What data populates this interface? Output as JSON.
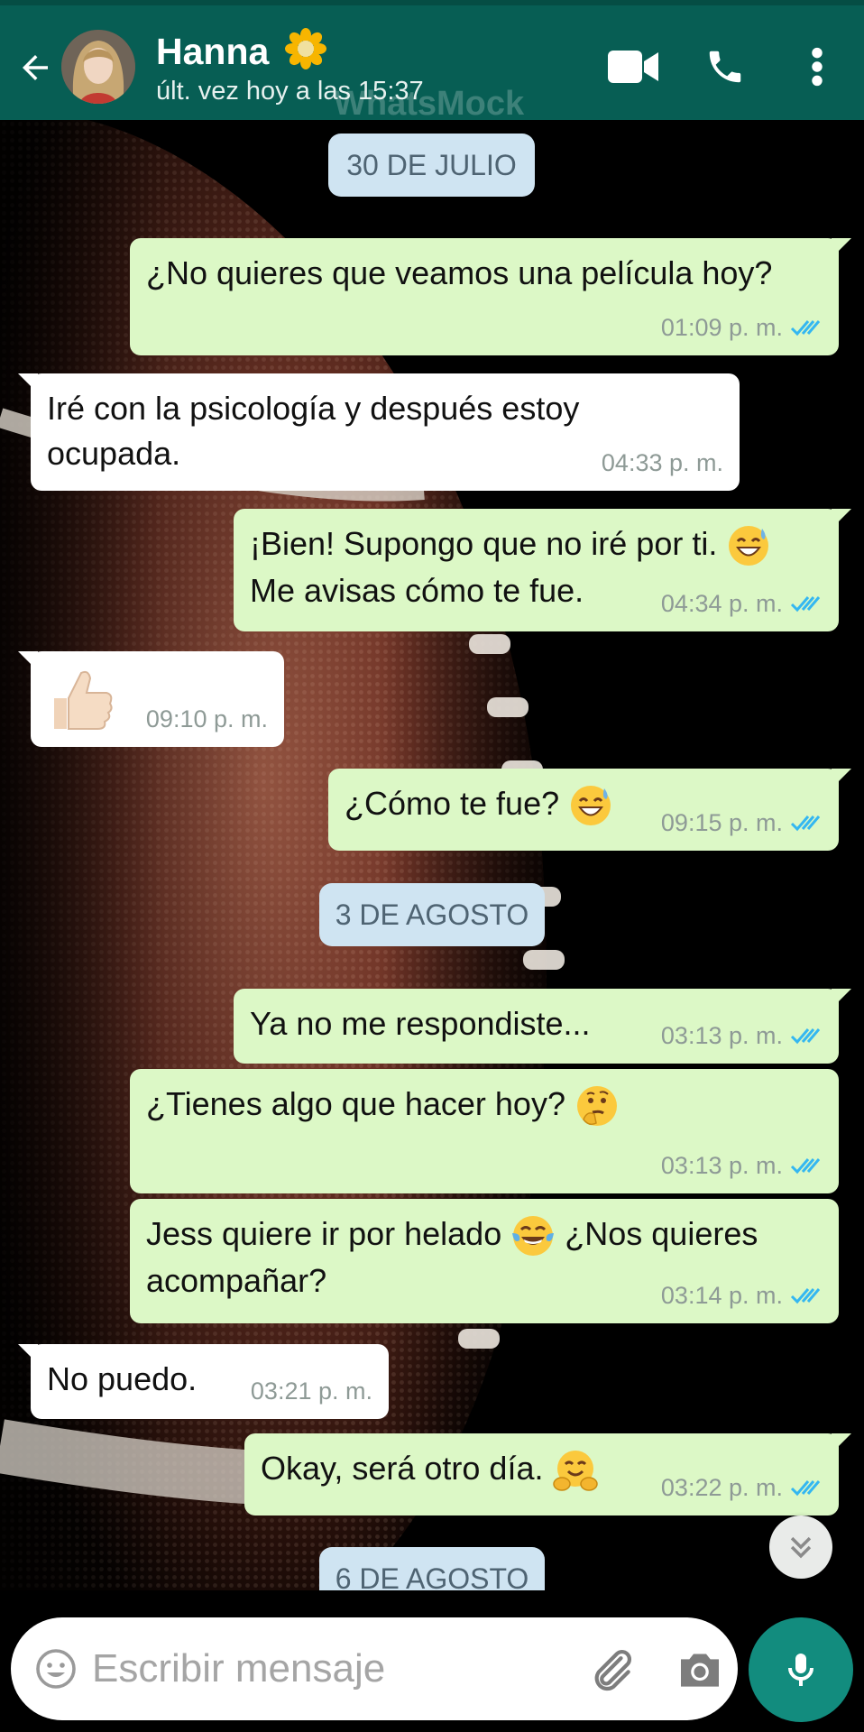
{
  "header": {
    "contact_name": "Hanna",
    "status": "últ. vez hoy a las 15:37",
    "watermark": "WhatsMock",
    "colors": {
      "bar": "#075e54"
    },
    "icons": [
      "back-arrow-icon",
      "video-call-icon",
      "phone-icon",
      "more-options-icon"
    ]
  },
  "dates": [
    "30 DE JULIO",
    "3 DE AGOSTO",
    "6 DE AGOSTO"
  ],
  "messages": [
    {
      "dir": "out",
      "text": "¿No quieres que veamos una película hoy?",
      "time": "01:09 p. m.",
      "read": true
    },
    {
      "dir": "in",
      "text": "Iré con la psicología y después estoy ocupada.",
      "time": "04:33 p. m."
    },
    {
      "dir": "out",
      "text": "¡Bien! Supongo que no iré por ti.",
      "text2": "Me avisas cómo te fue.",
      "emoji": "grinning-sweat",
      "time": "04:34 p. m.",
      "read": true
    },
    {
      "dir": "in",
      "text": "",
      "emoji": "thumbs-up",
      "time": "09:10 p. m."
    },
    {
      "dir": "out",
      "text": "¿Cómo te fue?",
      "emoji": "grinning-sweat",
      "time": "09:15 p. m.",
      "read": true
    },
    {
      "dir": "out",
      "text": "Ya no me respondiste...",
      "time": "03:13 p. m.",
      "read": true
    },
    {
      "dir": "out",
      "text": "¿Tienes algo que hacer hoy?",
      "emoji": "thinking",
      "time": "03:13 p. m.",
      "read": true
    },
    {
      "dir": "out",
      "text": "Jess quiere ir por helado",
      "text2": "¿Nos quieres acompañar?",
      "emoji": "tears-of-joy",
      "time": "03:14 p. m.",
      "read": true
    },
    {
      "dir": "in",
      "text": "No puedo.",
      "time": "03:21 p. m."
    },
    {
      "dir": "out",
      "text": "Okay, será otro día.",
      "emoji": "hugging",
      "time": "03:22 p. m.",
      "read": true
    }
  ],
  "input": {
    "placeholder": "Escribir mensaje",
    "value": ""
  },
  "colors": {
    "outgoing_bubble": "#dcf8c6",
    "incoming_bubble": "#ffffff",
    "read_ticks": "#34b7f1",
    "mic_button": "#128c7e"
  }
}
